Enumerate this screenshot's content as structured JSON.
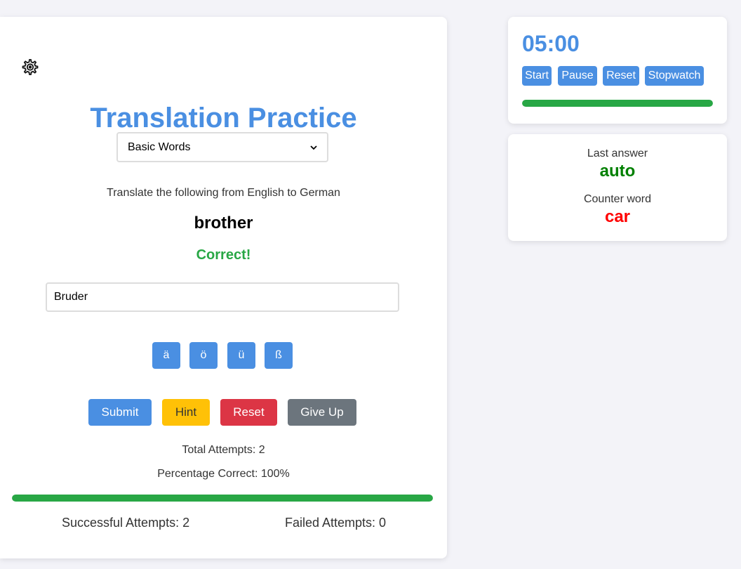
{
  "app": {
    "title": "Translation Practice",
    "settings_icon": "gear-icon"
  },
  "category": {
    "selected": "Basic Words"
  },
  "prompt": {
    "instruction": "Translate the following from English to German",
    "word": "brother",
    "feedback": "Correct!",
    "feedback_color": "#28a745"
  },
  "answer": {
    "value": "Bruder",
    "placeholder": ""
  },
  "special_chars": [
    "ä",
    "ö",
    "ü",
    "ß"
  ],
  "actions": {
    "submit": "Submit",
    "hint": "Hint",
    "reset": "Reset",
    "give_up": "Give Up"
  },
  "colors": {
    "accent": "#4a8fe2",
    "submit": "#4a8fe2",
    "hint": "#ffc107",
    "reset": "#dc3545",
    "give_up": "#6c757d",
    "success": "#28a745",
    "counter": "#ff0000",
    "last_answer": "#008000"
  },
  "stats": {
    "total_attempts": "Total Attempts: 2",
    "percentage_correct": "Percentage Correct: 100%",
    "progress_fraction": 1.0,
    "successful": "Successful Attempts: 2",
    "failed": "Failed Attempts: 0"
  },
  "timer": {
    "display": "05:00",
    "buttons": {
      "start": "Start",
      "pause": "Pause",
      "reset": "Reset",
      "stopwatch": "Stopwatch"
    },
    "progress_fraction": 1.0
  },
  "info": {
    "last_answer_label": "Last answer",
    "last_answer": "auto",
    "counter_word_label": "Counter word",
    "counter_word": "car"
  }
}
